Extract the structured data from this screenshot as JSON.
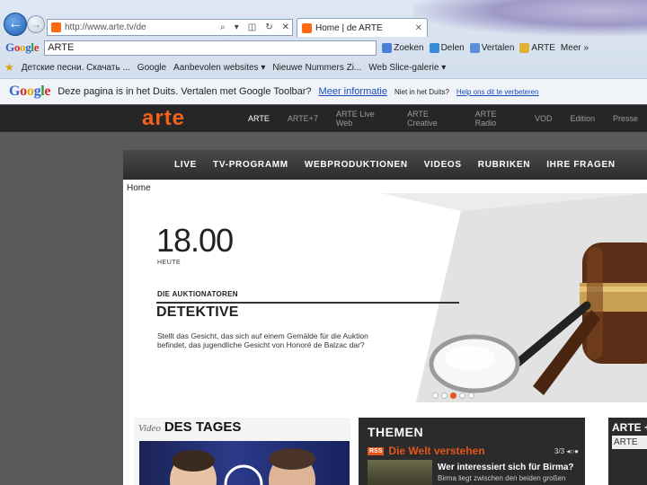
{
  "browser": {
    "address_url": "http://www.arte.tv/de",
    "tab_title": "Home | de   ARTE",
    "google_search_value": "ARTE",
    "toolbar": {
      "search_label": "Zoeken",
      "share_label": "Delen",
      "translate_label": "Vertalen",
      "arte_label": "ARTE",
      "more_label": "Meer »"
    },
    "favorites": [
      {
        "label": "Детские песни. Скачать ..."
      },
      {
        "label": "Google"
      },
      {
        "label": "Aanbevolen websites ▾"
      },
      {
        "label": "Nieuwe Nummers   Zi..."
      },
      {
        "label": "Web Slice-galerie ▾"
      }
    ],
    "notice": {
      "text": "Deze pagina is in het Duits. Vertalen met Google Toolbar?",
      "more_link": "Meer informatie",
      "not_german": "Niet in het Duits?",
      "help_link": "Help ons dit te verbeteren"
    }
  },
  "site": {
    "logo": "arte",
    "nav": [
      "ARTE",
      "ARTE+7",
      "ARTE Live Web",
      "ARTE Creative",
      "ARTE Radio",
      "VOD",
      "Edition",
      "Presse"
    ],
    "main_nav": [
      "LIVE",
      "TV-PROGRAMM",
      "WEBPRODUKTIONEN",
      "VIDEOS",
      "RUBRIKEN",
      "IHRE FRAGEN"
    ],
    "breadcrumb": "Home"
  },
  "hero": {
    "time": "18.00",
    "day": "HEUTE",
    "kicker": "DIE AUKTIONATOREN",
    "title": "DETEKTIVE",
    "description": "Stellt das Gesicht, das sich auf einem Gemälde für die Auktion befindet, das jugendliche Gesicht von Honoré de Balzac dar?",
    "slide_count": 5,
    "active_slide": 3
  },
  "video_des_tages": {
    "prefix": "Video",
    "title": "DES TAGES"
  },
  "themen": {
    "title": "THEMEN",
    "rss": "RSS",
    "subtitle": "Die Welt verstehen",
    "pager": "3/3",
    "headline": "Wer interessiert sich für Birma?",
    "teaser": "Birma liegt zwischen den beiden großen"
  },
  "arte_plus": {
    "title": "ARTE +",
    "box_text": "ARTE"
  },
  "colors": {
    "arte_orange": "#f3611a",
    "accent": "#e4551c",
    "dark_bar": "#262626"
  }
}
